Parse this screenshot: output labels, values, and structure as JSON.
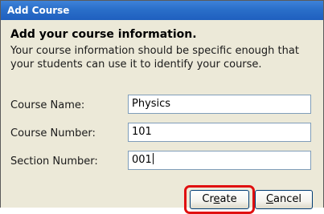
{
  "window": {
    "title": "Add Course"
  },
  "form": {
    "heading": "Add your course information.",
    "description": "Your course information should be specific enough that your students can use it to identify your course.",
    "fields": [
      {
        "label": "Course Name:",
        "value": "Physics"
      },
      {
        "label": "Course Number:",
        "value": "101"
      },
      {
        "label": "Section Number:",
        "value": "001"
      }
    ]
  },
  "buttons": {
    "create": {
      "label": "Create",
      "accelerator": "e"
    },
    "cancel": {
      "label": "Cancel",
      "accelerator": "C"
    }
  },
  "highlight_color": "#e01010",
  "titlebar_color": "#2a6fc9"
}
